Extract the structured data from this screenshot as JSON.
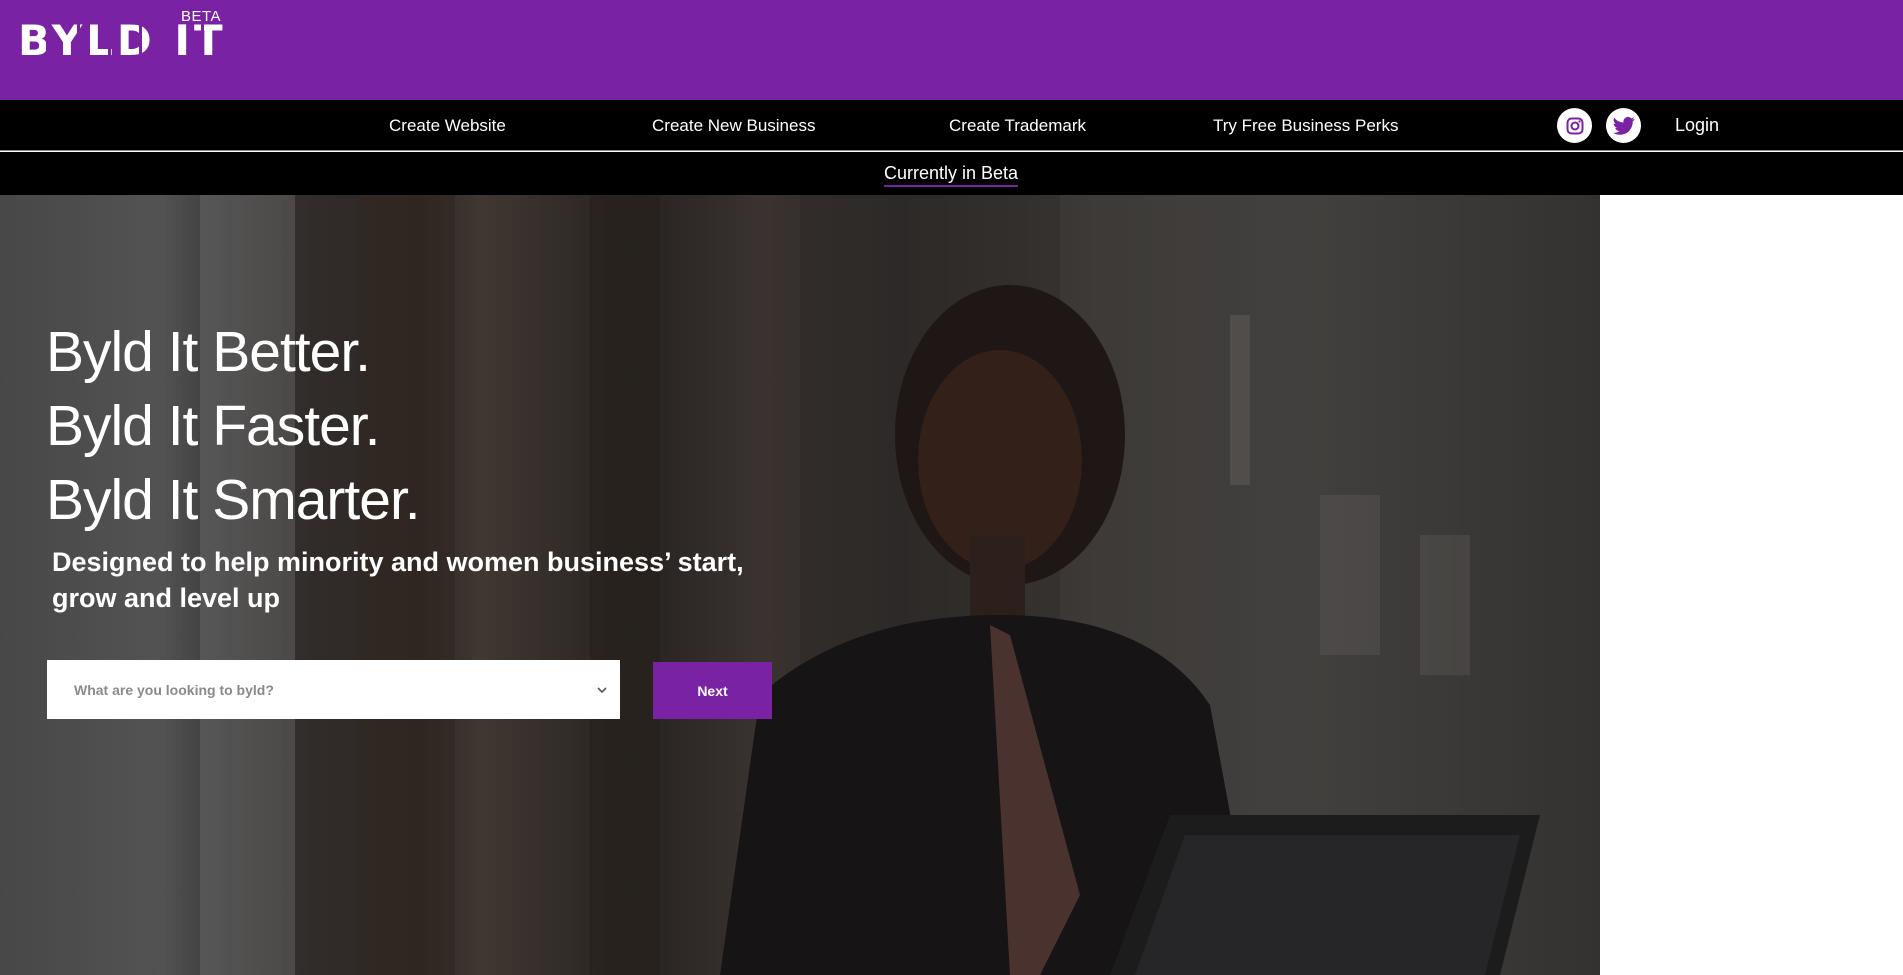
{
  "brand": {
    "logo_text": "BYLD IT",
    "beta_tag": "BETA",
    "primary_color": "#7a22a4"
  },
  "nav": {
    "links": [
      {
        "label": "Create Website"
      },
      {
        "label": "Create New Business"
      },
      {
        "label": "Create Trademark"
      },
      {
        "label": "Try Free Business Perks"
      }
    ],
    "social": [
      {
        "icon": "instagram-icon"
      },
      {
        "icon": "twitter-icon"
      }
    ],
    "login_label": "Login"
  },
  "beta_banner": {
    "label": "Currently in Beta"
  },
  "hero": {
    "headlines": [
      "Byld It Better.",
      "Byld It Faster.",
      "Byld It Smarter."
    ],
    "subtitle": "Designed to help minority and women business’ start, grow and level up",
    "select": {
      "placeholder": "What are you looking to byld?"
    },
    "next_label": "Next"
  }
}
